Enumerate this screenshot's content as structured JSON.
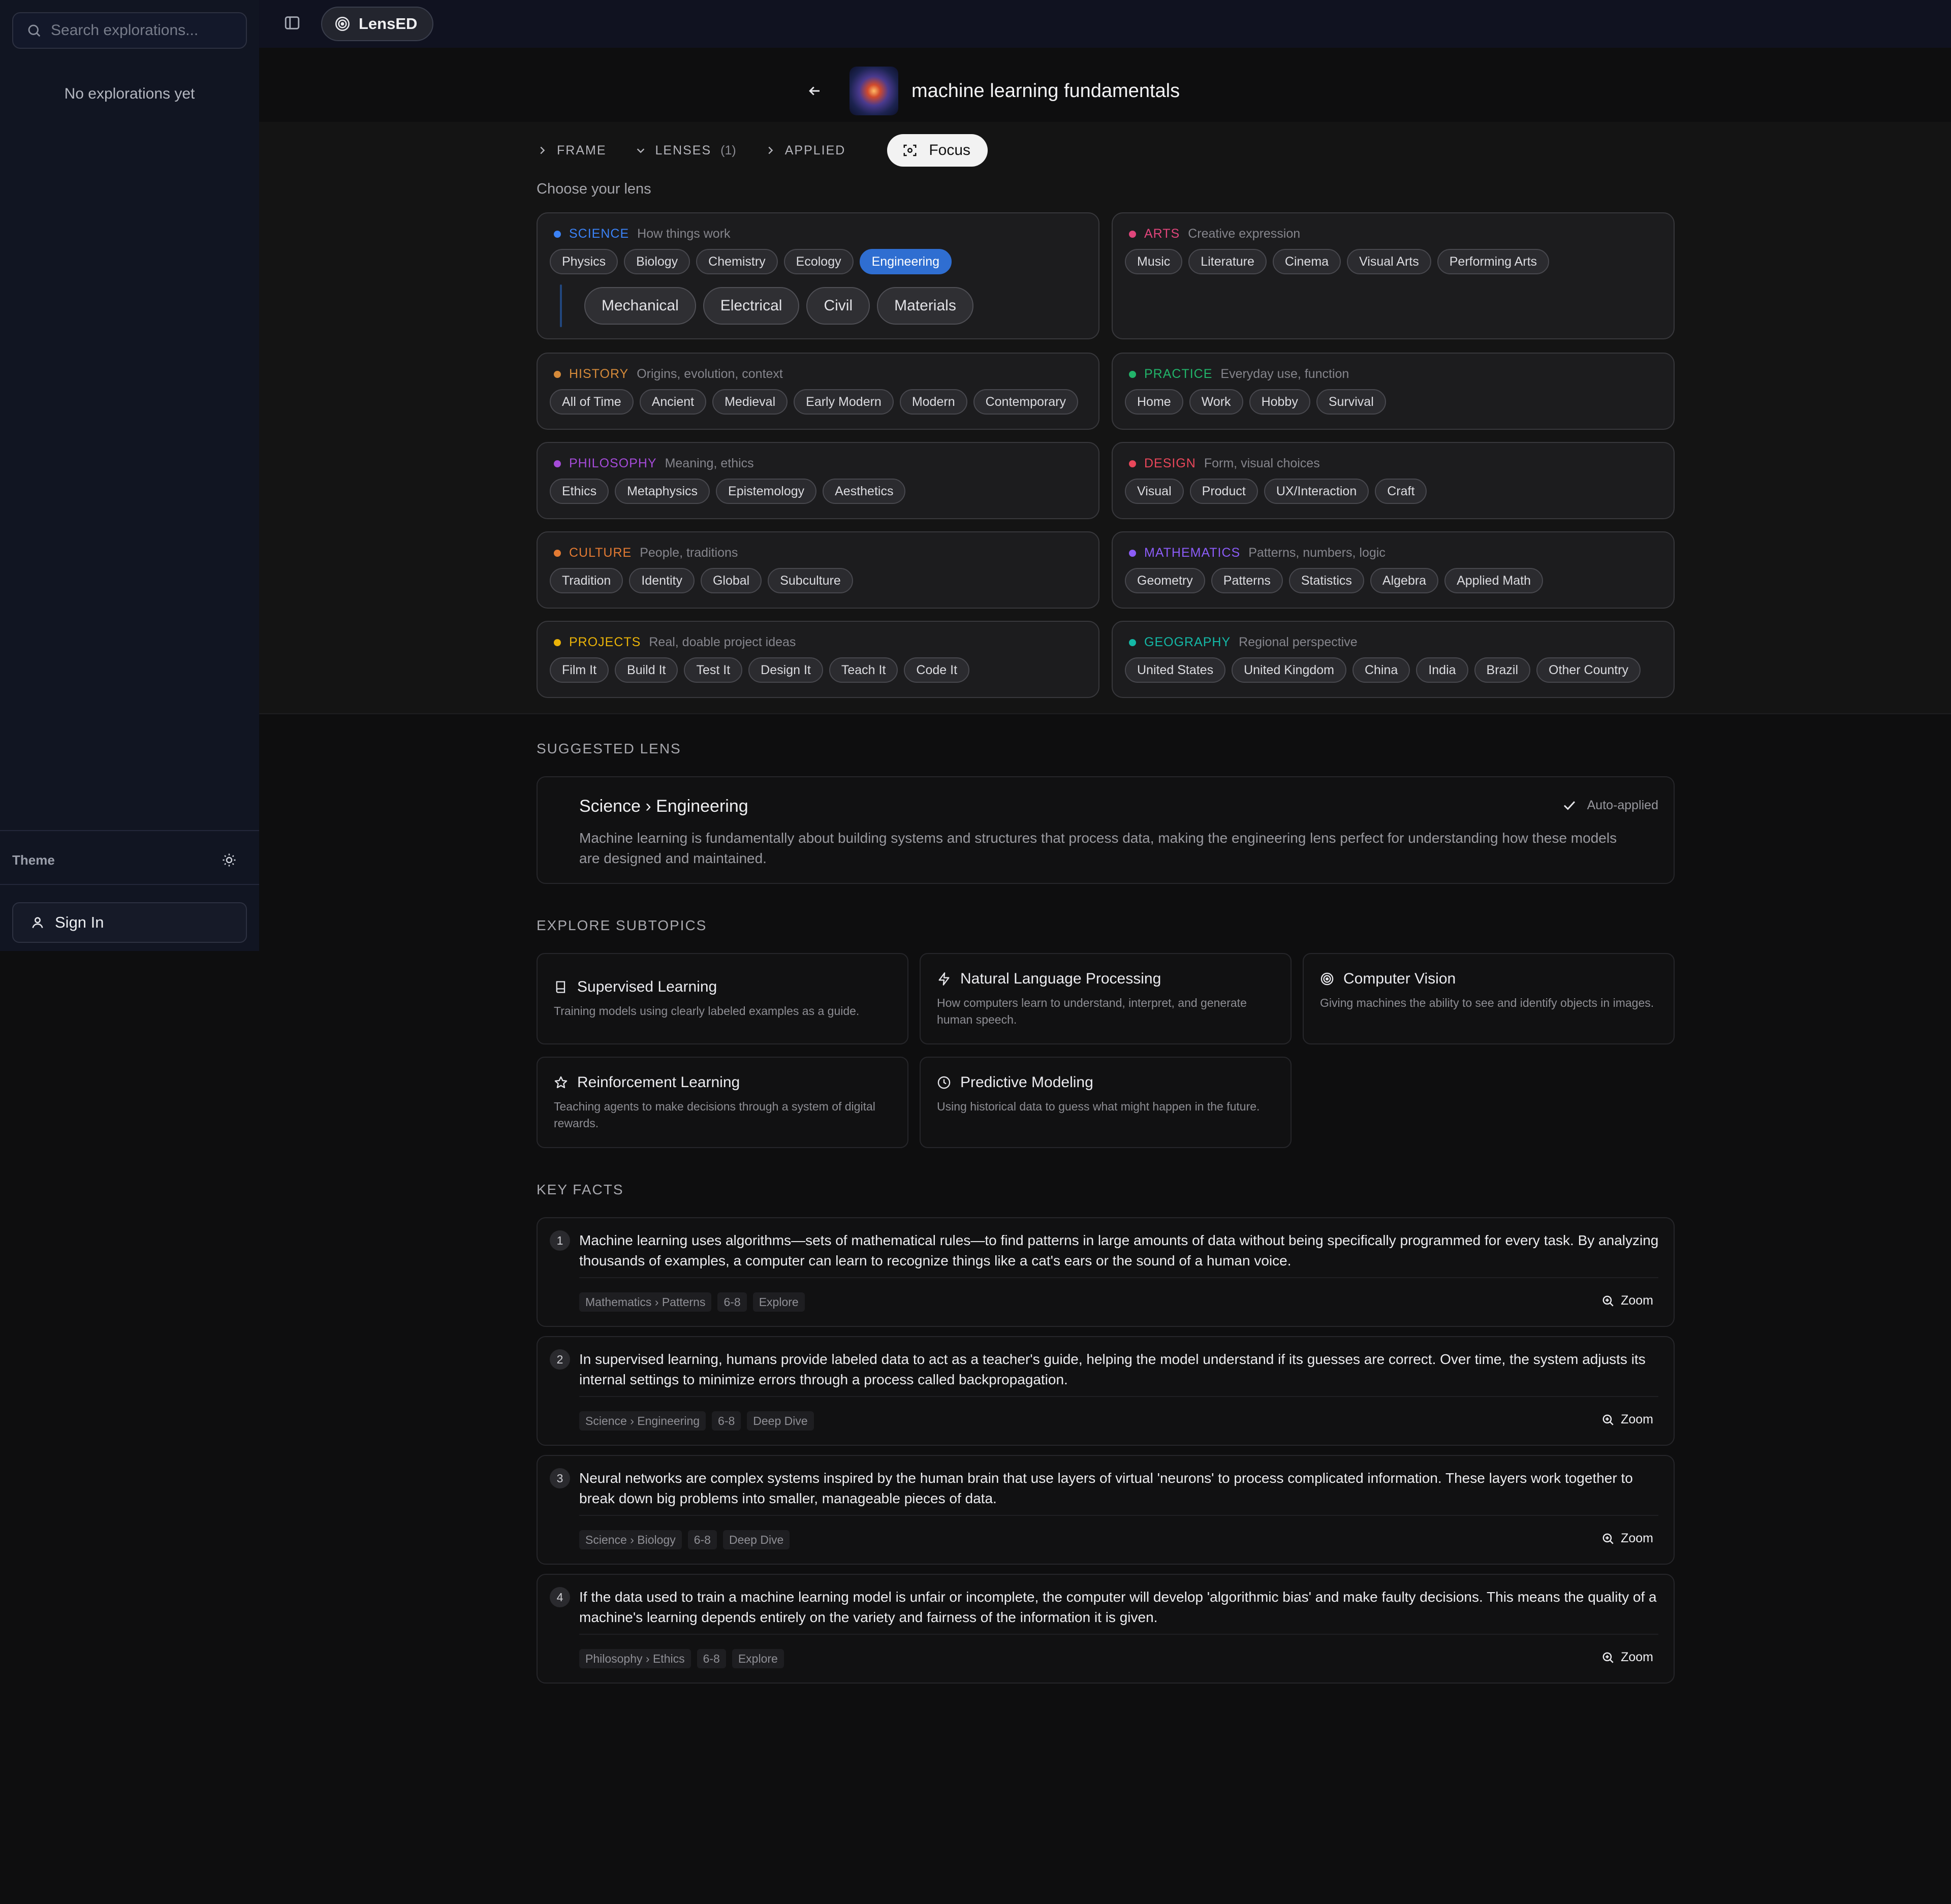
{
  "sidebar": {
    "search_placeholder": "Search explorations...",
    "empty_text": "No explorations yet",
    "theme_label": "Theme",
    "sign_in_label": "Sign In"
  },
  "topbar": {
    "brand": "LensED"
  },
  "header": {
    "title": "machine learning fundamentals"
  },
  "tabs": {
    "frame": "FRAME",
    "lenses": "LENSES",
    "lenses_count": "(1)",
    "applied": "APPLIED",
    "focus": "Focus"
  },
  "choose_label": "Choose your lens",
  "categories": [
    {
      "name": "SCIENCE",
      "desc": "How things work",
      "color": "#3b82f6",
      "items": [
        "Physics",
        "Biology",
        "Chemistry",
        "Ecology",
        "Engineering"
      ],
      "active": "Engineering",
      "subitems": [
        "Mechanical",
        "Electrical",
        "Civil",
        "Materials"
      ]
    },
    {
      "name": "ARTS",
      "desc": "Creative expression",
      "color": "#e0457b",
      "items": [
        "Music",
        "Literature",
        "Cinema",
        "Visual Arts",
        "Performing Arts"
      ]
    },
    {
      "name": "HISTORY",
      "desc": "Origins, evolution, context",
      "color": "#d58a3a",
      "items": [
        "All of Time",
        "Ancient",
        "Medieval",
        "Early Modern",
        "Modern",
        "Contemporary"
      ]
    },
    {
      "name": "PRACTICE",
      "desc": "Everyday use, function",
      "color": "#22b46a",
      "items": [
        "Home",
        "Work",
        "Hobby",
        "Survival"
      ]
    },
    {
      "name": "PHILOSOPHY",
      "desc": "Meaning, ethics",
      "color": "#a54bd8",
      "items": [
        "Ethics",
        "Metaphysics",
        "Epistemology",
        "Aesthetics"
      ]
    },
    {
      "name": "DESIGN",
      "desc": "Form, visual choices",
      "color": "#e8475a",
      "items": [
        "Visual",
        "Product",
        "UX/Interaction",
        "Craft"
      ]
    },
    {
      "name": "CULTURE",
      "desc": "People, traditions",
      "color": "#e27a33",
      "items": [
        "Tradition",
        "Identity",
        "Global",
        "Subculture"
      ]
    },
    {
      "name": "MATHEMATICS",
      "desc": "Patterns, numbers, logic",
      "color": "#8b5cf6",
      "items": [
        "Geometry",
        "Patterns",
        "Statistics",
        "Algebra",
        "Applied Math"
      ]
    },
    {
      "name": "PROJECTS",
      "desc": "Real, doable project ideas",
      "color": "#eab308",
      "items": [
        "Film It",
        "Build It",
        "Test It",
        "Design It",
        "Teach It",
        "Code It"
      ]
    },
    {
      "name": "GEOGRAPHY",
      "desc": "Regional perspective",
      "color": "#14b8a6",
      "items": [
        "United States",
        "United Kingdom",
        "China",
        "India",
        "Brazil",
        "Other Country"
      ]
    }
  ],
  "suggested": {
    "heading": "SUGGESTED LENS",
    "title": "Science › Engineering",
    "status": "Auto-applied",
    "text": "Machine learning is fundamentally about building systems and structures that process data, making the engineering lens perfect for understanding how these models are designed and maintained."
  },
  "subtopics": {
    "heading": "EXPLORE SUBTOPICS",
    "items": [
      {
        "title": "Supervised Learning",
        "desc": "Training models using clearly labeled examples as a guide.",
        "icon": "book-icon"
      },
      {
        "title": "Natural Language Processing",
        "desc": "How computers learn to understand, interpret, and generate human speech.",
        "icon": "lightning-icon"
      },
      {
        "title": "Computer Vision",
        "desc": "Giving machines the ability to see and identify objects in images.",
        "icon": "target-icon"
      },
      {
        "title": "Reinforcement Learning",
        "desc": "Teaching agents to make decisions through a system of digital rewards.",
        "icon": "star-icon"
      },
      {
        "title": "Predictive Modeling",
        "desc": "Using historical data to guess what might happen in the future.",
        "icon": "clock-icon"
      }
    ]
  },
  "facts": {
    "heading": "KEY FACTS",
    "zoom_label": "Zoom",
    "items": [
      {
        "num": "1",
        "text": "Machine learning uses algorithms—sets of mathematical rules—to find patterns in large amounts of data without being specifically programmed for every task. By analyzing thousands of examples, a computer can learn to recognize things like a cat's ears or the sound of a human voice.",
        "tags": [
          "Mathematics › Patterns",
          "6-8",
          "Explore"
        ]
      },
      {
        "num": "2",
        "text": "In supervised learning, humans provide labeled data to act as a teacher's guide, helping the model understand if its guesses are correct. Over time, the system adjusts its internal settings to minimize errors through a process called backpropagation.",
        "tags": [
          "Science › Engineering",
          "6-8",
          "Deep Dive"
        ]
      },
      {
        "num": "3",
        "text": "Neural networks are complex systems inspired by the human brain that use layers of virtual 'neurons' to process complicated information. These layers work together to break down big problems into smaller, manageable pieces of data.",
        "tags": [
          "Science › Biology",
          "6-8",
          "Deep Dive"
        ]
      },
      {
        "num": "4",
        "text": "If the data used to train a machine learning model is unfair or incomplete, the computer will develop 'algorithmic bias' and make faulty decisions. This means the quality of a machine's learning depends entirely on the variety and fairness of the information it is given.",
        "tags": [
          "Philosophy › Ethics",
          "6-8",
          "Explore"
        ]
      }
    ]
  }
}
